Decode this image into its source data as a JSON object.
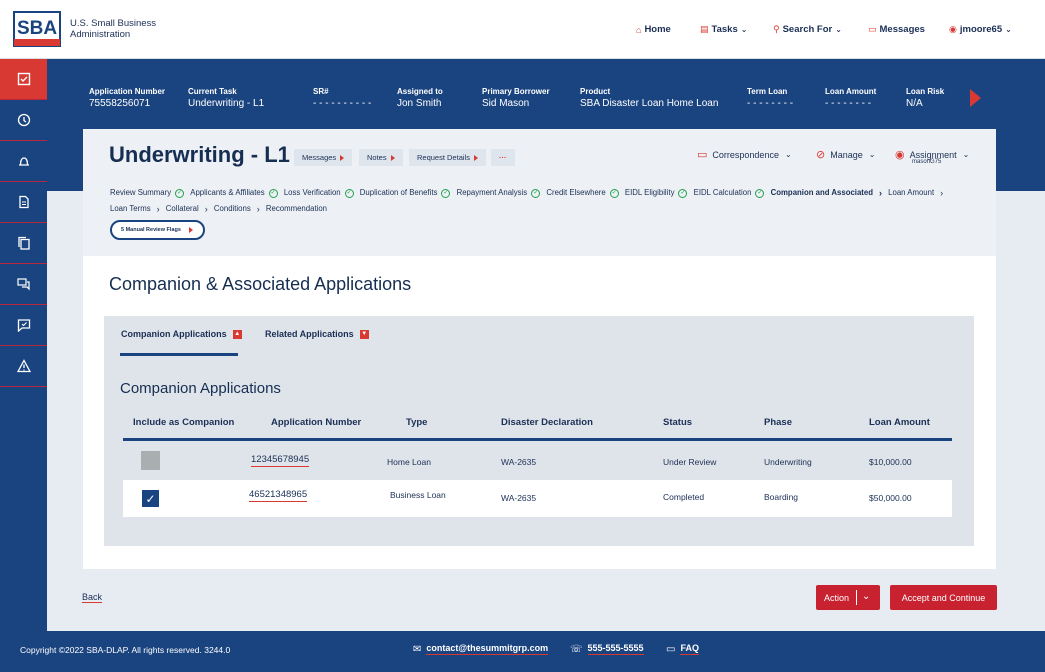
{
  "header": {
    "logo_text": "SBA",
    "org_line1": "U.S. Small Business",
    "org_line2": "Administration",
    "nav": {
      "home": "Home",
      "tasks": "Tasks",
      "search": "Search For",
      "messages": "Messages",
      "user": "jmoore65"
    }
  },
  "app_info": {
    "application_number": {
      "label": "Application Number",
      "value": "75558256071"
    },
    "current_task": {
      "label": "Current Task",
      "value": "Underwriting - L1"
    },
    "sr": {
      "label": "SR#",
      "value": "- - - - - - - - - -"
    },
    "assigned_to": {
      "label": "Assigned to",
      "value": "Jon Smith"
    },
    "primary_borrower": {
      "label": "Primary Borrower",
      "value": "Sid Mason"
    },
    "product": {
      "label": "Product",
      "value": "SBA Disaster Loan Home Loan"
    },
    "term_loan": {
      "label": "Term Loan",
      "value": "- - - - - - - -"
    },
    "loan_amount": {
      "label": "Loan Amount",
      "value": "- - - - - - - -"
    },
    "loan_risk": {
      "label": "Loan Risk",
      "value": "N/A"
    }
  },
  "page": {
    "title": "Underwriting - L1",
    "chips": {
      "messages": "Messages",
      "notes": "Notes",
      "request_details": "Request Details",
      "more": "···"
    },
    "menus": {
      "correspondence": "Correspondence",
      "manage": "Manage",
      "assignment": "Assignment",
      "assignment_sub": "masonG75"
    },
    "steps": [
      {
        "label": "Review Summary",
        "status": "done"
      },
      {
        "label": "Applicants & Affiliates",
        "status": "done"
      },
      {
        "label": "Loss Verification",
        "status": "done"
      },
      {
        "label": "Duplication of Benefits",
        "status": "done"
      },
      {
        "label": "Repayment Analysis",
        "status": "done"
      },
      {
        "label": "Credit Elsewhere",
        "status": "done"
      },
      {
        "label": "EIDL Eligibility",
        "status": "done"
      },
      {
        "label": "EIDL Calculation",
        "status": "done"
      },
      {
        "label": "Companion and Associated",
        "status": "current"
      },
      {
        "label": "Loan Amount",
        "status": "todo"
      },
      {
        "label": "Loan Terms",
        "status": "todo"
      },
      {
        "label": "Collateral",
        "status": "todo"
      },
      {
        "label": "Conditions",
        "status": "todo"
      },
      {
        "label": "Recommendation",
        "status": "todo"
      }
    ],
    "flags_button": "5 Manual Review Flags",
    "section_title": "Companion & Associated Applications"
  },
  "panel": {
    "tabs": {
      "companion": "Companion Applications",
      "related": "Related Applications"
    },
    "subtitle": "Companion Applications",
    "columns": {
      "include": "Include as Companion",
      "app_number": "Application Number",
      "type": "Type",
      "disaster": "Disaster Declaration",
      "status": "Status",
      "phase": "Phase",
      "amount": "Loan Amount"
    },
    "rows": [
      {
        "checked": false,
        "app_number": "12345678945",
        "type": "Home Loan",
        "disaster": "WA-2635",
        "status": "Under Review",
        "phase": "Underwriting",
        "amount": "$10,000.00"
      },
      {
        "checked": true,
        "app_number": "46521348965",
        "type": "Business Loan",
        "disaster": "WA-2635",
        "status": "Completed",
        "phase": "Boarding",
        "amount": "$50,000.00"
      }
    ]
  },
  "actions": {
    "back": "Back",
    "action": "Action",
    "accept": "Accept and Continue"
  },
  "footer": {
    "copyright": "Copyright ©2022 SBA-DLAP. All rights reserved. 3244.0",
    "email": "contact@thesummitgrp.com",
    "phone": "555-555-5555",
    "faq": "FAQ"
  },
  "colors": {
    "navy": "#1a4480",
    "red": "#d83933",
    "green": "#22a14b"
  }
}
